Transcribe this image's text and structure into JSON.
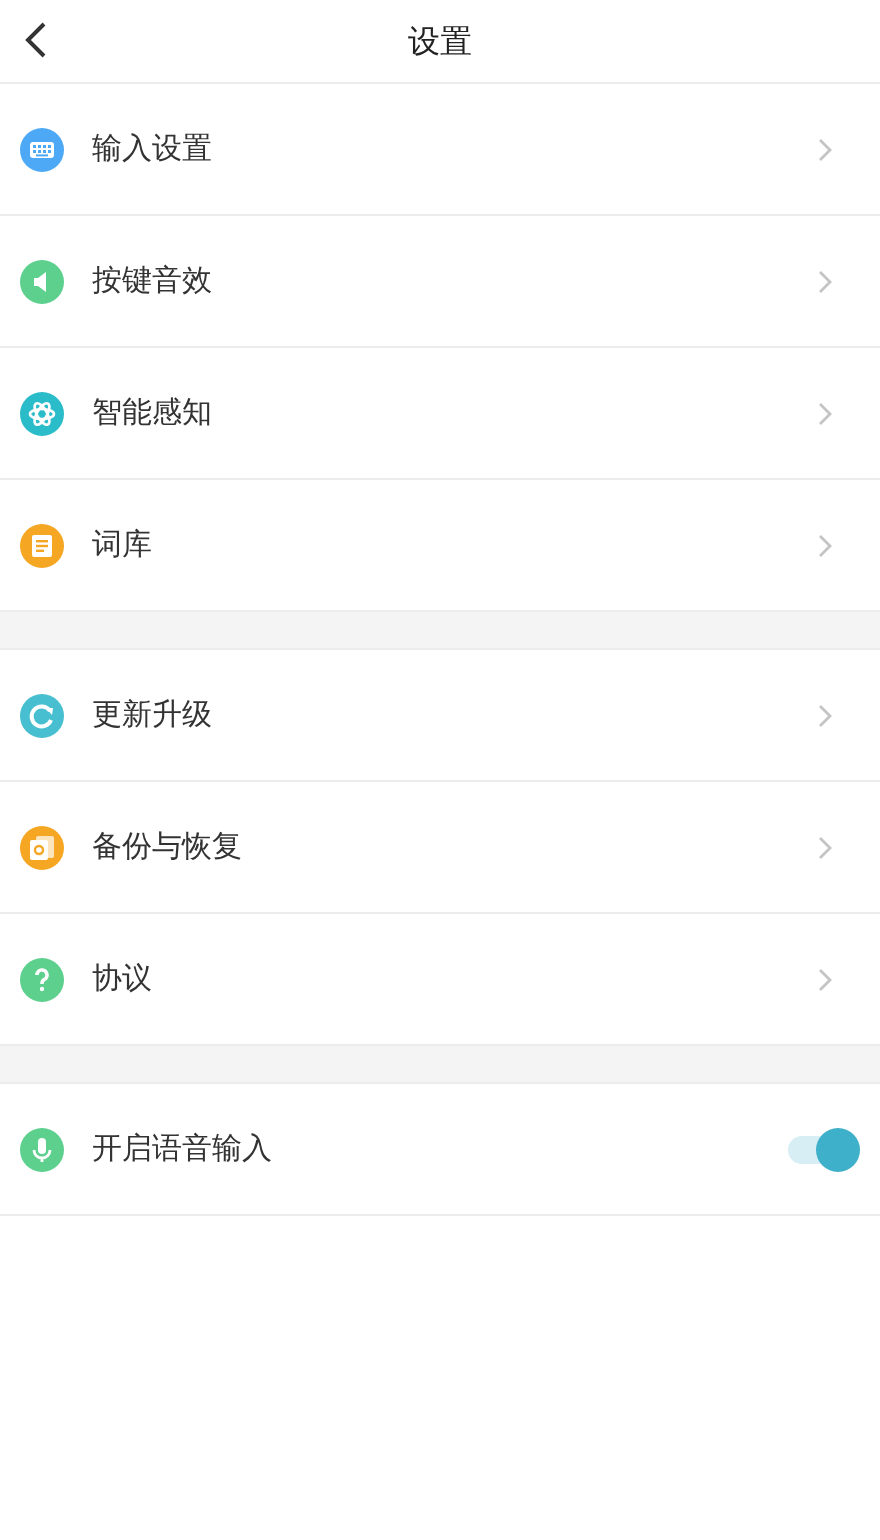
{
  "header": {
    "title": "设置"
  },
  "sections": [
    {
      "items": [
        {
          "kind": "link",
          "label": "输入设置",
          "color": "#4da8f5"
        },
        {
          "kind": "link",
          "label": "按键音效",
          "color": "#5dd08e"
        },
        {
          "kind": "link",
          "label": "智能感知",
          "color": "#2bbcc9"
        },
        {
          "kind": "link",
          "label": "词库",
          "color": "#f5a623"
        }
      ]
    },
    {
      "items": [
        {
          "kind": "link",
          "label": "更新升级",
          "color": "#47bfd0"
        },
        {
          "kind": "link",
          "label": "备份与恢复",
          "color": "#f5a623"
        },
        {
          "kind": "link",
          "label": "协议",
          "color": "#5dd08e"
        }
      ]
    },
    {
      "items": [
        {
          "kind": "toggle",
          "label": "开启语音输入",
          "color": "#5dd08e",
          "on": true
        }
      ]
    }
  ]
}
